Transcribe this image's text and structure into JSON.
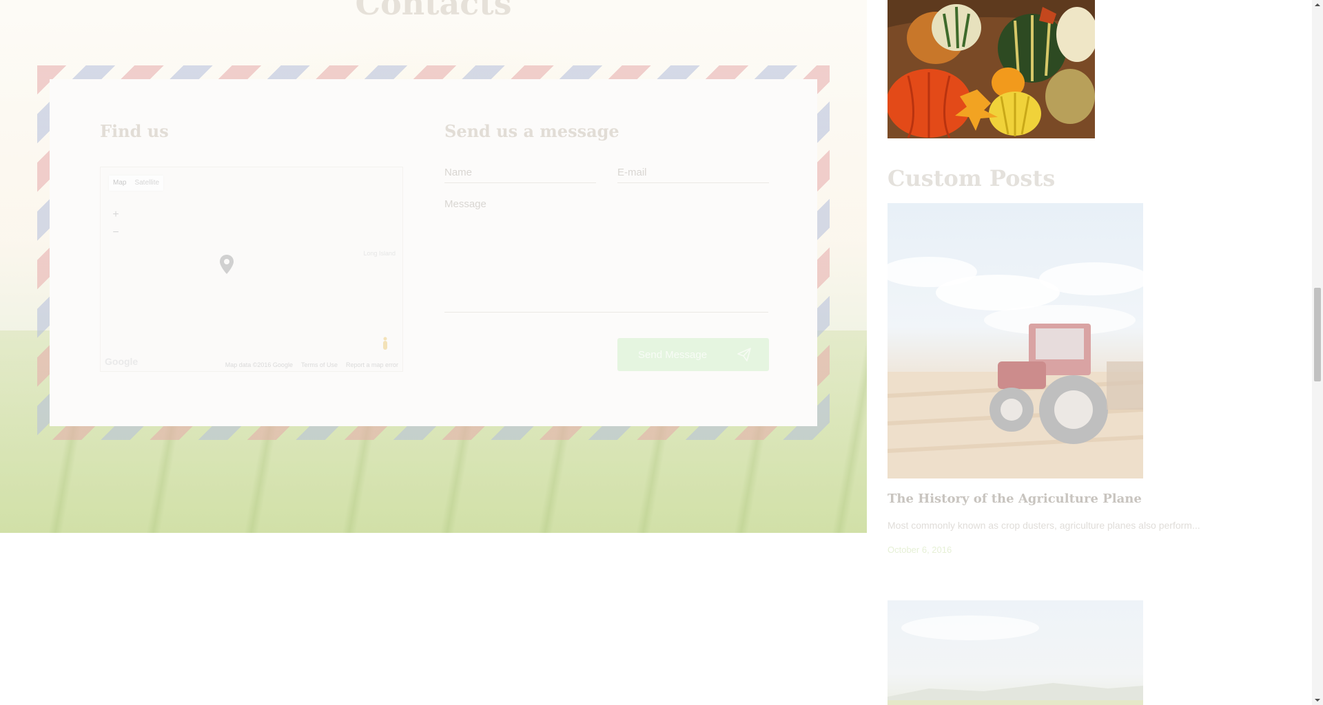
{
  "page": {
    "title": "Contacts"
  },
  "contact": {
    "find_us_heading": "Find us",
    "send_heading": "Send us a message",
    "map": {
      "type_map": "Map",
      "type_satellite": "Satellite",
      "zoom_in": "+",
      "zoom_out": "−",
      "place_label": "Long Island",
      "logo": "Google",
      "footer_data": "Map data ©2016 Google",
      "footer_terms": "Terms of Use",
      "footer_report": "Report a map error"
    },
    "form": {
      "name_placeholder": "Name",
      "email_placeholder": "E-mail",
      "message_placeholder": "Message",
      "send_label": "Send Message"
    }
  },
  "sidebar": {
    "custom_posts_heading": "Custom Posts",
    "posts": [
      {
        "title": "The History of the Agriculture Plane",
        "excerpt": "Most commonly known as crop dusters, agriculture planes also perform...",
        "date": "October 6, 2016"
      }
    ]
  },
  "colors": {
    "accent_green": "#8cc63f",
    "heading_gray": "#e2ddd6"
  },
  "icons": {
    "map_pin": "map-pin-icon",
    "pegman": "pegman-icon",
    "send": "paper-plane-icon"
  }
}
